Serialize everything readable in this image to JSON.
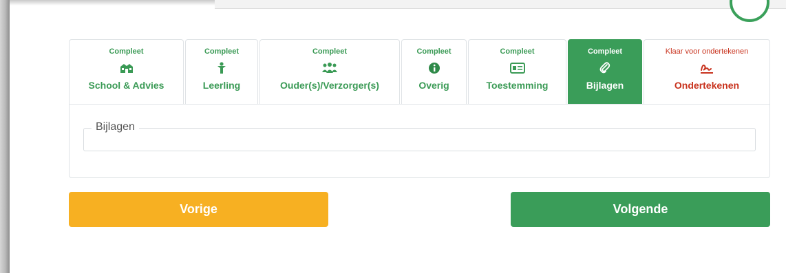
{
  "tabs": [
    {
      "status": "Compleet",
      "label": "School & Advies",
      "icon": "school-icon"
    },
    {
      "status": "Compleet",
      "label": "Leerling",
      "icon": "person-icon"
    },
    {
      "status": "Compleet",
      "label": "Ouder(s)/Verzorger(s)",
      "icon": "users-icon"
    },
    {
      "status": "Compleet",
      "label": "Overig",
      "icon": "info-icon"
    },
    {
      "status": "Compleet",
      "label": "Toestemming",
      "icon": "id-card-icon"
    },
    {
      "status": "Compleet",
      "label": "Bijlagen",
      "icon": "paperclip-icon",
      "active": true
    },
    {
      "status": "Klaar voor ondertekenen",
      "label": "Ondertekenen",
      "icon": "signature-icon"
    }
  ],
  "section": {
    "legend": "Bijlagen"
  },
  "buttons": {
    "prev": "Vorige",
    "next": "Volgende"
  },
  "colors": {
    "complete": "#3a9a55",
    "active_bg": "#3a9d59",
    "pending": "#c8321d",
    "prev_button": "#f7b022",
    "next_button": "#3a9d59"
  }
}
